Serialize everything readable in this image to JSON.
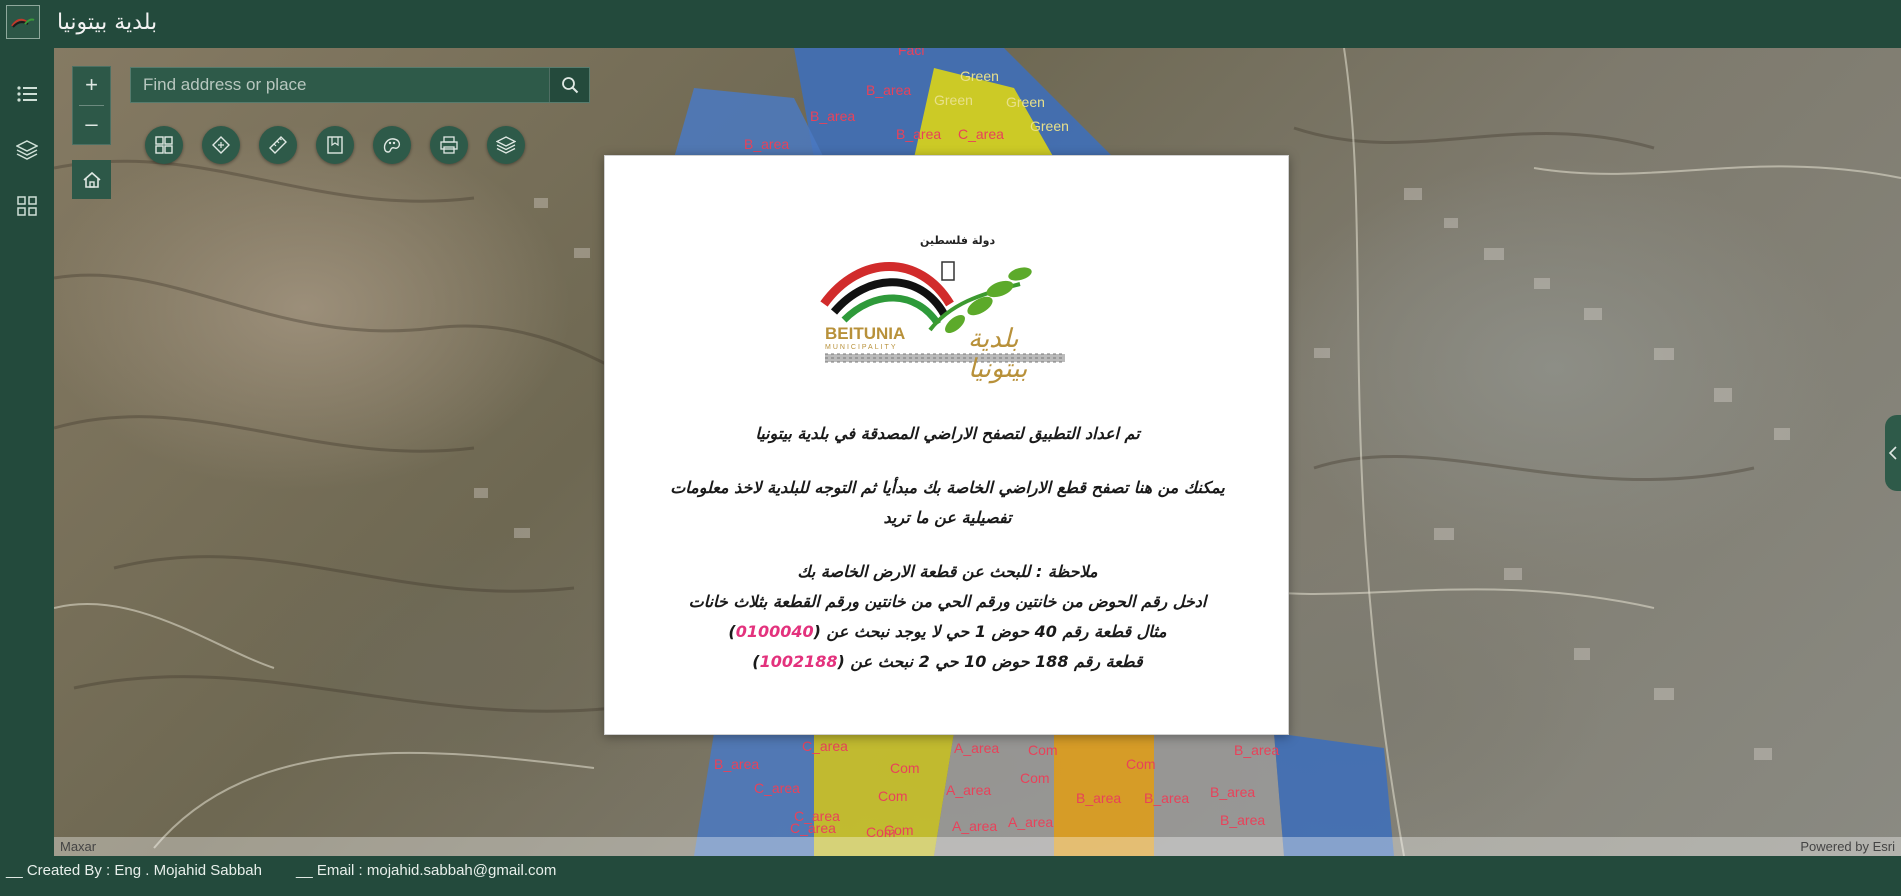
{
  "header": {
    "title": "بلدية بيتونيا"
  },
  "rail": {
    "icons": [
      "list-icon",
      "layers-icon",
      "grid-icon"
    ]
  },
  "map": {
    "search": {
      "placeholder": "Find address or place",
      "value": ""
    },
    "zoom_in_label": "+",
    "zoom_out_label": "–",
    "tools": [
      "basemap-gallery-icon",
      "measure-icon",
      "ruler-icon",
      "bookmark-icon",
      "sketch-icon",
      "print-icon",
      "layer-list-icon"
    ],
    "attribution_left": "Maxar",
    "attribution_right": "Powered by Esri",
    "parcel_labels": [
      "Faci",
      "B_area",
      "Green",
      "B_area",
      "Green",
      "Green",
      "B_area",
      "B_area",
      "C_area",
      "Green",
      "C_area",
      "B_area",
      "Com",
      "A_area",
      "Com",
      "Com",
      "B_area",
      "C_area",
      "Com",
      "A_area",
      "Com",
      "B_area",
      "C_area",
      "Com",
      "A_area",
      "B_area",
      "B_area",
      "C_area",
      "Com",
      "A_area",
      "B_area"
    ]
  },
  "modal": {
    "logo_state_text": "دولة فلسطين",
    "logo_en_name": "BEITUNIA",
    "logo_en_sub": "MUNICIPALITY",
    "logo_ar_name": "بلدية بيتونيا",
    "line1": "تم اعداد التطبيق لتصفح الاراضي المصدقة في بلدية بيتونيا",
    "line2": "يمكنك من هنا تصفح قطع الاراضي الخاصة بك مبدأيا ثم التوجه للبلدية لاخذ معلومات",
    "line3": "تفصيلية عن ما تريد",
    "line4": "ملاحظة : للبحث عن قطعة الارض الخاصة بك",
    "line5": "ادخل رقم الحوض من خانتين ورقم الحي من خانتين ورقم القطعة بثلاث خانات",
    "line6_prefix": "مثال قطعة رقم 40 حوض 1 حي لا يوجد نبحث عن (",
    "line6_code": "0100040",
    "line6_suffix": ")",
    "line7_prefix": "قطعة رقم 188 حوض 10 حي 2 نبحث عن (",
    "line7_code": "1002188",
    "line7_suffix": ")"
  },
  "footer": {
    "created_by": "__ Created By : Eng . Mojahid Sabbah",
    "email": "__  Email : mojahid.sabbah@gmail.com"
  }
}
